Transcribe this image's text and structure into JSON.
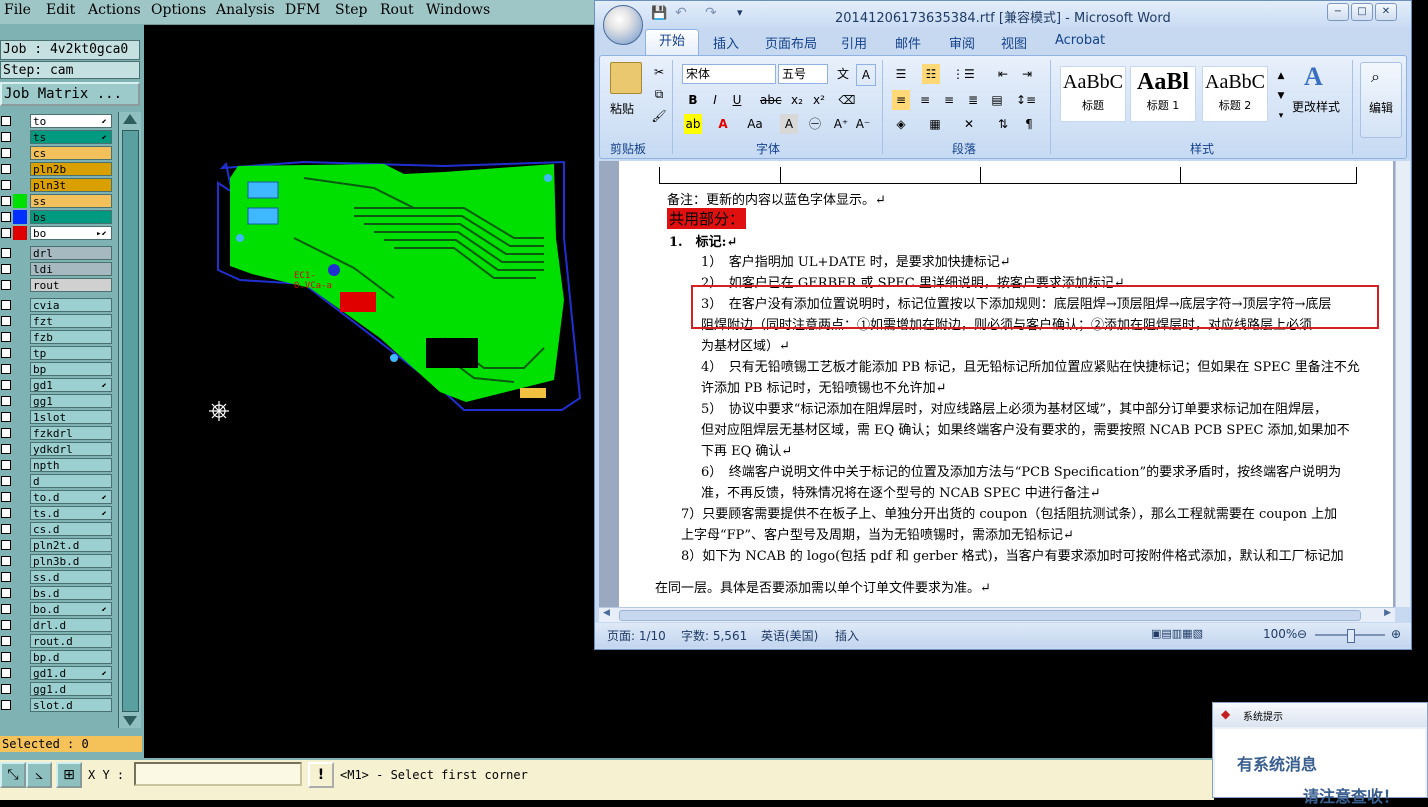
{
  "genesis": {
    "menu": [
      "File",
      "Edit",
      "Actions",
      "Options",
      "Analysis",
      "DFM",
      "Step",
      "Rout",
      "Windows"
    ],
    "job_label": "Job : 4v2kt0gca0",
    "step_label": "Step: cam",
    "job_matrix_button": "Job Matrix ...",
    "selected_label": "Selected : 0",
    "xy_label": "X Y :",
    "xy_value": "",
    "prompt_button": "!",
    "prompt_text": "<M1> - Select first corner",
    "layers": [
      {
        "name": "to",
        "color": "#ffffff",
        "swatch": "",
        "flag": "⬋"
      },
      {
        "name": "ts",
        "color": "#009a80",
        "swatch": "",
        "flag": "⬋"
      },
      {
        "name": "cs",
        "color": "#f2c15c",
        "swatch": "",
        "flag": ""
      },
      {
        "name": "pln2b",
        "color": "#d9a000",
        "swatch": "",
        "flag": ""
      },
      {
        "name": "pln3t",
        "color": "#d9a000",
        "swatch": "",
        "flag": ""
      },
      {
        "name": "ss",
        "color": "#f2c15c",
        "swatch": "#00e000",
        "flag": ""
      },
      {
        "name": "bs",
        "color": "#009a80",
        "swatch": "#0030ff",
        "flag": ""
      },
      {
        "name": "bo",
        "color": "#ffffff",
        "swatch": "#e00000",
        "flag": "▸⬋"
      },
      {
        "name": "drl",
        "color": "#a6b8c0",
        "swatch": "",
        "flag": ""
      },
      {
        "name": "ldi",
        "color": "#a6b8c0",
        "swatch": "",
        "flag": ""
      },
      {
        "name": "rout",
        "color": "#d0d0d0",
        "swatch": "",
        "flag": ""
      },
      {
        "name": "cvia",
        "color": "#9cd0d0",
        "swatch": "",
        "flag": ""
      },
      {
        "name": "fzt",
        "color": "#9cd0d0",
        "swatch": "",
        "flag": ""
      },
      {
        "name": "fzb",
        "color": "#9cd0d0",
        "swatch": "",
        "flag": ""
      },
      {
        "name": "tp",
        "color": "#9cd0d0",
        "swatch": "",
        "flag": ""
      },
      {
        "name": "bp",
        "color": "#9cd0d0",
        "swatch": "",
        "flag": ""
      },
      {
        "name": "gd1",
        "color": "#9cd0d0",
        "swatch": "",
        "flag": "⬋"
      },
      {
        "name": "gg1",
        "color": "#9cd0d0",
        "swatch": "",
        "flag": ""
      },
      {
        "name": "1slot",
        "color": "#9cd0d0",
        "swatch": "",
        "flag": ""
      },
      {
        "name": "fzkdrl",
        "color": "#9cd0d0",
        "swatch": "",
        "flag": ""
      },
      {
        "name": "ydkdrl",
        "color": "#9cd0d0",
        "swatch": "",
        "flag": ""
      },
      {
        "name": "npth",
        "color": "#9cd0d0",
        "swatch": "",
        "flag": ""
      },
      {
        "name": "d",
        "color": "#9cd0d0",
        "swatch": "",
        "flag": ""
      },
      {
        "name": "to.d",
        "color": "#9cd0d0",
        "swatch": "",
        "flag": "⬋"
      },
      {
        "name": "ts.d",
        "color": "#9cd0d0",
        "swatch": "",
        "flag": "⬋"
      },
      {
        "name": "cs.d",
        "color": "#9cd0d0",
        "swatch": "",
        "flag": ""
      },
      {
        "name": "pln2t.d",
        "color": "#9cd0d0",
        "swatch": "",
        "flag": ""
      },
      {
        "name": "pln3b.d",
        "color": "#9cd0d0",
        "swatch": "",
        "flag": ""
      },
      {
        "name": "ss.d",
        "color": "#9cd0d0",
        "swatch": "",
        "flag": ""
      },
      {
        "name": "bs.d",
        "color": "#9cd0d0",
        "swatch": "",
        "flag": ""
      },
      {
        "name": "bo.d",
        "color": "#9cd0d0",
        "swatch": "",
        "flag": "⬋"
      },
      {
        "name": "drl.d",
        "color": "#9cd0d0",
        "swatch": "",
        "flag": ""
      },
      {
        "name": "rout.d",
        "color": "#9cd0d0",
        "swatch": "",
        "flag": ""
      },
      {
        "name": "bp.d",
        "color": "#9cd0d0",
        "swatch": "",
        "flag": ""
      },
      {
        "name": "gd1.d",
        "color": "#9cd0d0",
        "swatch": "",
        "flag": "⬋"
      },
      {
        "name": "gg1.d",
        "color": "#9cd0d0",
        "swatch": "",
        "flag": ""
      },
      {
        "name": "slot.d",
        "color": "#9cd0d0",
        "swatch": "",
        "flag": ""
      }
    ],
    "board_text": "EC1-",
    "board_text2": "0.VCa-a"
  },
  "word": {
    "title": "20141206173635384.rtf [兼容模式] - Microsoft Word",
    "tabs": [
      "开始",
      "插入",
      "页面布局",
      "引用",
      "邮件",
      "审阅",
      "视图",
      "Acrobat"
    ],
    "ribbon": {
      "clipboard_group": "剪贴板",
      "paste_label": "粘贴",
      "font_group": "字体",
      "font_name": "宋体",
      "font_size": "五号",
      "paragraph_group": "段落",
      "styles_group": "样式",
      "styles": [
        {
          "preview": "AaBbC",
          "name": "标题"
        },
        {
          "preview": "AaBl",
          "name": "标题 1"
        },
        {
          "preview": "AaBbC",
          "name": "标题 2"
        }
      ],
      "change_styles": "更改样式",
      "edit_label": "编辑"
    },
    "doc": {
      "note": "备注：更新的内容以蓝色字体显示。↵",
      "section": "共用部分：",
      "heading": "1.　标记:↵",
      "lines": [
        "1）　客户指明加 UL+DATE 时，是要求加快捷标记↵",
        "2）　如客户已在 GERBER 或 SPEC 里详细说明，按客户要求添加标记↵",
        "3）　在客户没有添加位置说明时，标记位置按以下添加规则：底层阻焊→顶层阻焊→底层字符→顶层字符→底层",
        "阻焊附边（同时注意两点：①如需增加在附边，则必须与客户确认；②添加在阻焊层时，对应线路层上必须",
        "为基材区域）↵",
        "4）　只有无铅喷锡工艺板才能添加 PB 标记，且无铅标记所加位置应紧贴在快捷标记；但如果在 SPEC 里备注不允",
        "许添加 PB 标记时，无铅喷锡也不允许加↵",
        "5）　协议中要求“标记添加在阻焊层时，对应线路层上必须为基材区域”，其中部分订单要求标记加在阻焊层，",
        "但对应阻焊层无基材区域，需 EQ 确认；如果终端客户没有要求的，需要按照 NCAB PCB SPEC 添加,如果加不",
        "下再 EQ 确认↵",
        "6）　终端客户说明文件中关于标记的位置及添加方法与“PCB Specification”的要求矛盾时，按终端客户说明为",
        "准，不再反馈，特殊情况将在逐个型号的 NCAB SPEC 中进行备注↵",
        "7）只要顾客需要提供不在板子上、单独分开出货的 coupon（包括阻抗测试条），那么工程就需要在 coupon 上加",
        "上字母“FP”、客户型号及周期，当为无铅喷锡时，需添加无铅标记↵",
        "8）如下为 NCAB 的 logo(包括 pdf 和 gerber 格式)，当客户有要求添加时可按附件格式添加，默认和工厂标记加",
        "在同一层。具体是否要添加需以单个订单文件要求为准。↵"
      ]
    },
    "status": {
      "page": "页面: 1/10",
      "words": "字数: 5,561",
      "lang": "英语(美国)",
      "mode": "插入",
      "zoom": "100%"
    }
  },
  "popup": {
    "title": "系统提示",
    "msg1": "有系统消息",
    "msg2": "请注意查收！"
  },
  "colors": {
    "board_green": "#00e000",
    "board_outline": "#2030d0",
    "annotation_red": "#e02020"
  }
}
